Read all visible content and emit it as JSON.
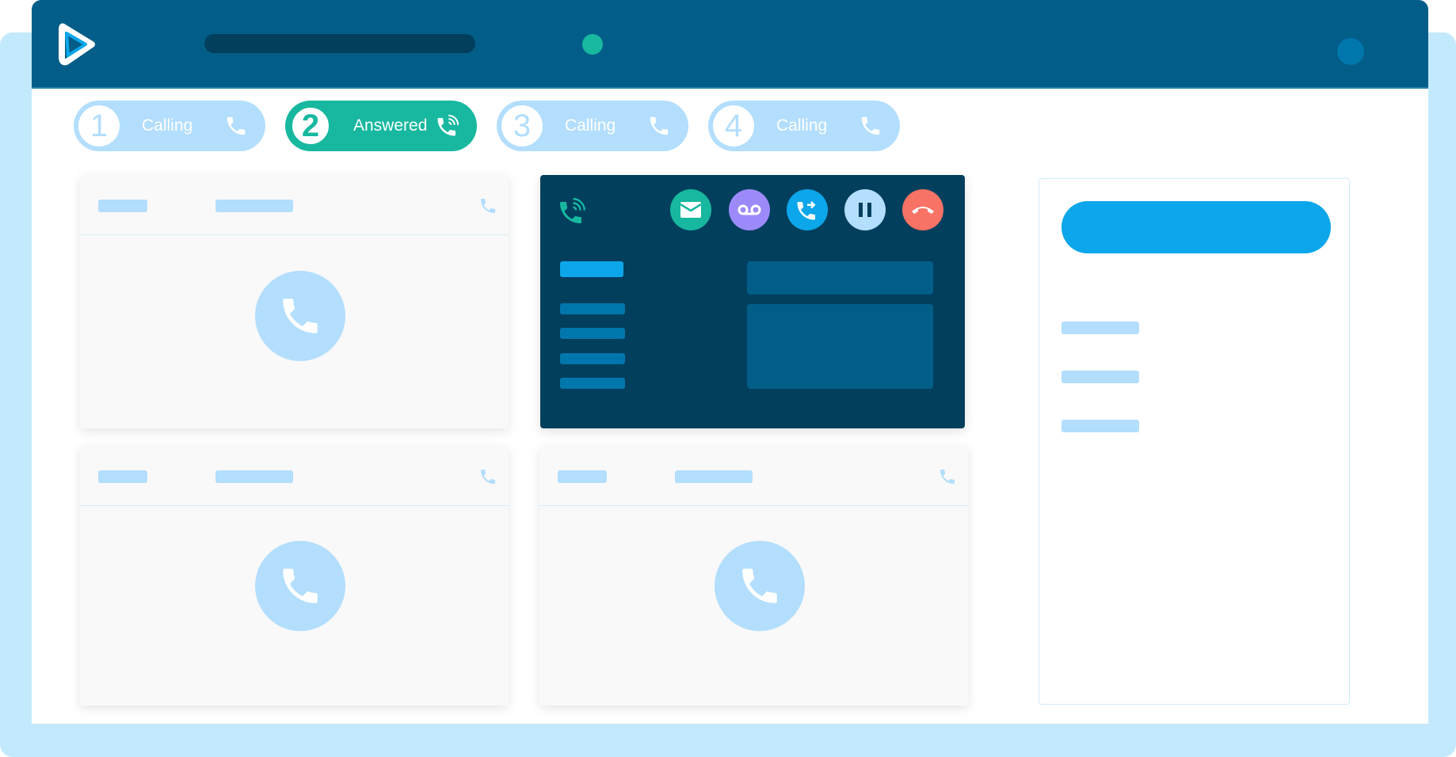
{
  "app": {
    "name": "Call Center Softphone",
    "colors": {
      "header": "#025d88",
      "accent_green": "#17b89f",
      "accent_blue": "#0ca6ea",
      "light_blue": "#b3defd",
      "dark_panel": "#013f5d",
      "hangup_red": "#f87265",
      "voicemail_purple": "#9d8afa"
    }
  },
  "header": {
    "logo_icon": "play-triangle-logo-icon",
    "search_placeholder": "",
    "status_icon": "online-status-dot",
    "avatar_icon": "user-avatar"
  },
  "call_tabs": [
    {
      "number": "1",
      "label": "Calling",
      "icon": "phone-icon",
      "active": false
    },
    {
      "number": "2",
      "label": "Answered",
      "icon": "phone-ringing-icon",
      "active": true
    },
    {
      "number": "3",
      "label": "Calling",
      "icon": "phone-icon",
      "active": false
    },
    {
      "number": "4",
      "label": "Calling",
      "icon": "phone-icon",
      "active": false
    }
  ],
  "active_call": {
    "status_icon": "phone-ringing-icon",
    "actions": [
      {
        "name": "email",
        "icon": "envelope-icon",
        "color": "#17b89f"
      },
      {
        "name": "voicemail",
        "icon": "voicemail-icon",
        "color": "#9d8afa"
      },
      {
        "name": "transfer",
        "icon": "phone-transfer-icon",
        "color": "#0ca6ea"
      },
      {
        "name": "hold",
        "icon": "pause-icon",
        "color": "#b3defd"
      },
      {
        "name": "hang-up",
        "icon": "phone-hangup-icon",
        "color": "#f87265"
      }
    ]
  },
  "call_cards": [
    {
      "id": "card-1",
      "icon": "phone-icon"
    },
    {
      "id": "card-3",
      "icon": "phone-icon"
    },
    {
      "id": "card-4",
      "icon": "phone-icon"
    }
  ]
}
